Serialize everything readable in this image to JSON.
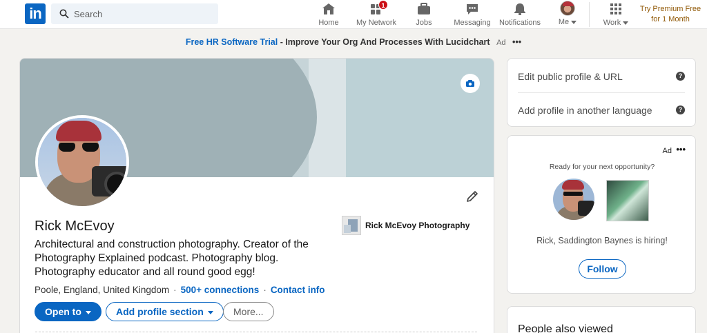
{
  "topnav": {
    "logo_text": "in",
    "search_placeholder": "Search",
    "items": [
      {
        "label": "Home",
        "icon": "home-icon"
      },
      {
        "label": "My Network",
        "icon": "network-icon",
        "badge": "1"
      },
      {
        "label": "Jobs",
        "icon": "briefcase-icon"
      },
      {
        "label": "Messaging",
        "icon": "messaging-icon"
      },
      {
        "label": "Notifications",
        "icon": "bell-icon"
      },
      {
        "label": "Me",
        "icon": "avatar"
      },
      {
        "label": "Work",
        "icon": "grid-icon"
      }
    ],
    "premium_line1": "Try Premium Free",
    "premium_line2": "for 1 Month"
  },
  "adbar": {
    "link": "Free HR Software Trial",
    "rest": " - Improve Your Org And Processes With Lucidchart",
    "ad": "Ad",
    "dots": "•••"
  },
  "profile": {
    "name": "Rick McEvoy",
    "headline": "Architectural and construction photography. Creator of the Photography Explained podcast. Photography blog. Photography educator and all round good egg!",
    "location": "Poole, England, United Kingdom",
    "connections": "500+ connections",
    "contact": "Contact info",
    "company": "Rick McEvoy Photography",
    "buttons": {
      "open_to": "Open to",
      "add_section": "Add profile section",
      "more": "More..."
    }
  },
  "sidebar": {
    "edit_public": "Edit public profile & URL",
    "add_language": "Add profile in another language",
    "help": "?",
    "ad": {
      "label": "Ad",
      "dots": "•••",
      "ready": "Ready for your next opportunity?",
      "hiring": "Rick, Saddington Baynes is hiring!",
      "follow": "Follow"
    },
    "people_also_viewed": "People also viewed"
  },
  "colors": {
    "brand_blue": "#0a66c2",
    "premium_gold": "#915907",
    "badge_red": "#cc1016",
    "page_bg": "#f3f2ef"
  }
}
